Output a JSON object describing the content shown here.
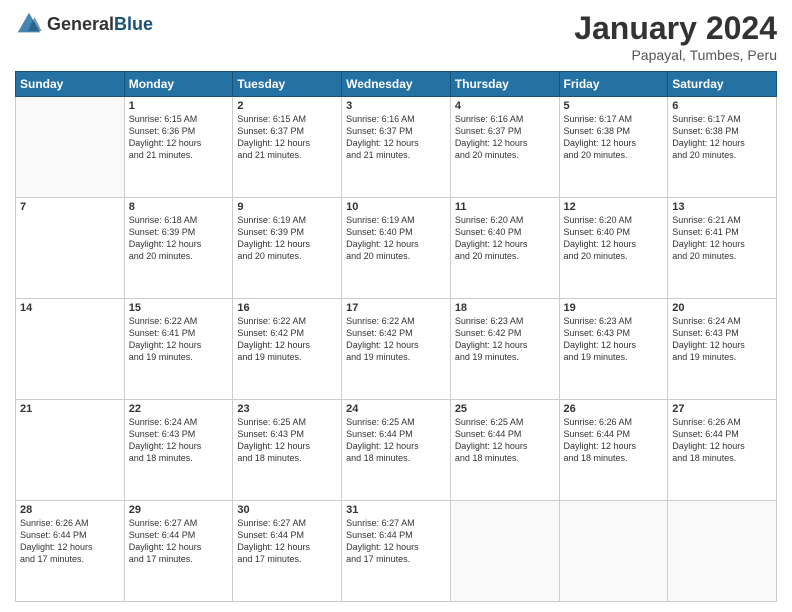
{
  "header": {
    "logo_general": "General",
    "logo_blue": "Blue",
    "month_year": "January 2024",
    "location": "Papayal, Tumbes, Peru"
  },
  "days_of_week": [
    "Sunday",
    "Monday",
    "Tuesday",
    "Wednesday",
    "Thursday",
    "Friday",
    "Saturday"
  ],
  "weeks": [
    [
      {
        "day": "",
        "info": ""
      },
      {
        "day": "1",
        "info": "Sunrise: 6:15 AM\nSunset: 6:36 PM\nDaylight: 12 hours\nand 21 minutes."
      },
      {
        "day": "2",
        "info": "Sunrise: 6:15 AM\nSunset: 6:37 PM\nDaylight: 12 hours\nand 21 minutes."
      },
      {
        "day": "3",
        "info": "Sunrise: 6:16 AM\nSunset: 6:37 PM\nDaylight: 12 hours\nand 21 minutes."
      },
      {
        "day": "4",
        "info": "Sunrise: 6:16 AM\nSunset: 6:37 PM\nDaylight: 12 hours\nand 20 minutes."
      },
      {
        "day": "5",
        "info": "Sunrise: 6:17 AM\nSunset: 6:38 PM\nDaylight: 12 hours\nand 20 minutes."
      },
      {
        "day": "6",
        "info": "Sunrise: 6:17 AM\nSunset: 6:38 PM\nDaylight: 12 hours\nand 20 minutes."
      }
    ],
    [
      {
        "day": "7",
        "info": ""
      },
      {
        "day": "8",
        "info": "Sunrise: 6:18 AM\nSunset: 6:39 PM\nDaylight: 12 hours\nand 20 minutes."
      },
      {
        "day": "9",
        "info": "Sunrise: 6:19 AM\nSunset: 6:39 PM\nDaylight: 12 hours\nand 20 minutes."
      },
      {
        "day": "10",
        "info": "Sunrise: 6:19 AM\nSunset: 6:40 PM\nDaylight: 12 hours\nand 20 minutes."
      },
      {
        "day": "11",
        "info": "Sunrise: 6:20 AM\nSunset: 6:40 PM\nDaylight: 12 hours\nand 20 minutes."
      },
      {
        "day": "12",
        "info": "Sunrise: 6:20 AM\nSunset: 6:40 PM\nDaylight: 12 hours\nand 20 minutes."
      },
      {
        "day": "13",
        "info": "Sunrise: 6:21 AM\nSunset: 6:41 PM\nDaylight: 12 hours\nand 20 minutes."
      }
    ],
    [
      {
        "day": "14",
        "info": ""
      },
      {
        "day": "15",
        "info": "Sunrise: 6:22 AM\nSunset: 6:41 PM\nDaylight: 12 hours\nand 19 minutes."
      },
      {
        "day": "16",
        "info": "Sunrise: 6:22 AM\nSunset: 6:42 PM\nDaylight: 12 hours\nand 19 minutes."
      },
      {
        "day": "17",
        "info": "Sunrise: 6:22 AM\nSunset: 6:42 PM\nDaylight: 12 hours\nand 19 minutes."
      },
      {
        "day": "18",
        "info": "Sunrise: 6:23 AM\nSunset: 6:42 PM\nDaylight: 12 hours\nand 19 minutes."
      },
      {
        "day": "19",
        "info": "Sunrise: 6:23 AM\nSunset: 6:43 PM\nDaylight: 12 hours\nand 19 minutes."
      },
      {
        "day": "20",
        "info": "Sunrise: 6:24 AM\nSunset: 6:43 PM\nDaylight: 12 hours\nand 19 minutes."
      }
    ],
    [
      {
        "day": "21",
        "info": ""
      },
      {
        "day": "22",
        "info": "Sunrise: 6:24 AM\nSunset: 6:43 PM\nDaylight: 12 hours\nand 18 minutes."
      },
      {
        "day": "23",
        "info": "Sunrise: 6:25 AM\nSunset: 6:43 PM\nDaylight: 12 hours\nand 18 minutes."
      },
      {
        "day": "24",
        "info": "Sunrise: 6:25 AM\nSunset: 6:44 PM\nDaylight: 12 hours\nand 18 minutes."
      },
      {
        "day": "25",
        "info": "Sunrise: 6:25 AM\nSunset: 6:44 PM\nDaylight: 12 hours\nand 18 minutes."
      },
      {
        "day": "26",
        "info": "Sunrise: 6:26 AM\nSunset: 6:44 PM\nDaylight: 12 hours\nand 18 minutes."
      },
      {
        "day": "27",
        "info": "Sunrise: 6:26 AM\nSunset: 6:44 PM\nDaylight: 12 hours\nand 18 minutes."
      }
    ],
    [
      {
        "day": "28",
        "info": "Sunrise: 6:26 AM\nSunset: 6:44 PM\nDaylight: 12 hours\nand 17 minutes."
      },
      {
        "day": "29",
        "info": "Sunrise: 6:27 AM\nSunset: 6:44 PM\nDaylight: 12 hours\nand 17 minutes."
      },
      {
        "day": "30",
        "info": "Sunrise: 6:27 AM\nSunset: 6:44 PM\nDaylight: 12 hours\nand 17 minutes."
      },
      {
        "day": "31",
        "info": "Sunrise: 6:27 AM\nSunset: 6:44 PM\nDaylight: 12 hours\nand 17 minutes."
      },
      {
        "day": "",
        "info": ""
      },
      {
        "day": "",
        "info": ""
      },
      {
        "day": "",
        "info": ""
      }
    ]
  ]
}
